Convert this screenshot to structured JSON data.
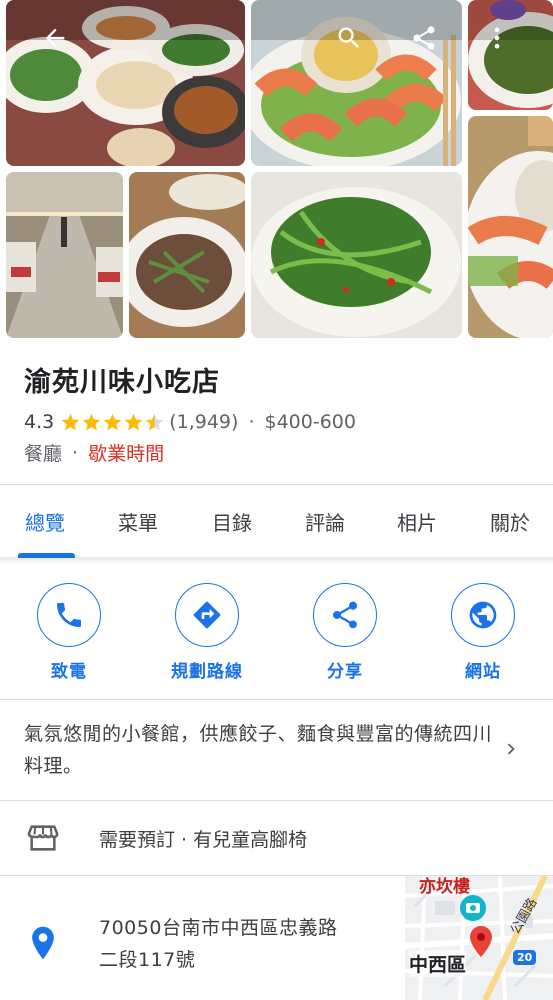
{
  "header": {
    "back_icon": "arrow-back-icon",
    "search_icon": "search-icon",
    "share_icon": "share-icon",
    "more_icon": "more-vert-icon"
  },
  "place": {
    "name": "渝苑川味小吃店",
    "rating": "4.3",
    "rating_value": 4.3,
    "review_count": "(1,949)",
    "price_range": "$400-600",
    "category": "餐廳",
    "separator": "·",
    "hours_status": "歇業時間"
  },
  "tabs": [
    {
      "label": "總覽",
      "active": true
    },
    {
      "label": "菜單",
      "active": false
    },
    {
      "label": "目錄",
      "active": false
    },
    {
      "label": "評論",
      "active": false
    },
    {
      "label": "相片",
      "active": false
    },
    {
      "label": "關於",
      "active": false
    }
  ],
  "actions": [
    {
      "label": "致電",
      "icon": "phone-icon"
    },
    {
      "label": "規劃路線",
      "icon": "directions-icon"
    },
    {
      "label": "分享",
      "icon": "share-icon"
    },
    {
      "label": "網站",
      "icon": "globe-icon"
    }
  ],
  "description": "氣氛悠閒的小餐館，供應餃子、麵食與豐富的傳統四川料理。",
  "amenities": "需要預訂 · 有兒童高腳椅",
  "address": {
    "line1": "70050台南市中西區忠義路",
    "line2": "二段117號"
  },
  "map": {
    "landmark": "亦坎樓",
    "district": "中西區",
    "road": "公園路",
    "route_number": "20"
  },
  "colors": {
    "accent": "#1a73e8",
    "closed": "#d93025",
    "star": "#fbbc04"
  }
}
